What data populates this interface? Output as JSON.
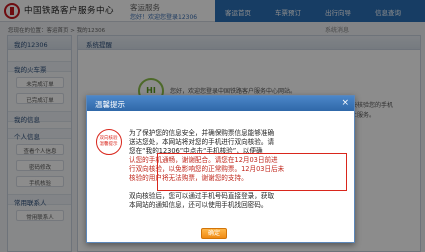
{
  "header": {
    "site_title": "中国铁路客户服务中心",
    "site_subtitle": "客运服务",
    "welcome_text": "您好！欢迎您登录12306",
    "nav": [
      "客运首页",
      "车票预订",
      "出行向导",
      "信息查询"
    ]
  },
  "breadcrumb": "您现在的位置：客运首页 > 我的12306",
  "system_message": "系统消息",
  "sidebar": {
    "title": "我的12306",
    "sections": [
      {
        "label": "我的火车票",
        "links": [
          "未完成订单",
          "已完成订单"
        ]
      },
      {
        "label": "我的信息",
        "links": []
      },
      {
        "label": "个人信息",
        "links": [
          "查看个人信息",
          "密码修改",
          "手机核验"
        ]
      },
      {
        "label": "常用联系人",
        "links": [
          "常用联系人"
        ]
      }
    ]
  },
  "main": {
    "panel_title": "系统提醒",
    "hint_badge": "HI",
    "user_line": "您好，欢迎您登录中国铁路客户服务中心网站。",
    "bg_note_1": "请您尽快核验您的手机",
    "bg_note_2": "后将停止服务。"
  },
  "dialog": {
    "title": "温馨提示",
    "close_icon": "×",
    "stamp_text": [
      "双向核验",
      "温馨提示"
    ],
    "lines": [
      "为了保护您的信息安全，并确保购票信息能够准确",
      "送达您处，本网站将对您的手机进行双向核验。请",
      "您在“我的12306”中点击“手机核验”，以便确",
      "认您的手机通畅，谢谢配合。请您在12月03日前进",
      "行双向核验，以免影响您的正常购票。12月03日后未",
      "核验的用户将无法购票，谢谢您的支持。",
      "双向核验后，您可以通过手机号码直接登录，获取",
      "本网站的通知信息，还可以使用手机找回密码。"
    ],
    "ok_label": "确定"
  },
  "colors": {
    "brand_red": "#c9161e",
    "nav_blue": "#2a6fb6",
    "highlight_red": "#d9261c",
    "button_orange": "#f08a12"
  }
}
